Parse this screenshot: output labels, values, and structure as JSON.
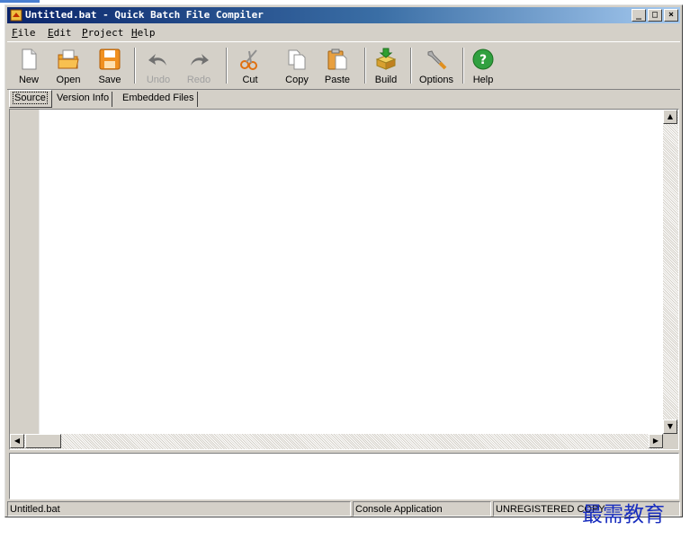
{
  "window": {
    "title": "Untitled.bat - Quick Batch File Compiler",
    "controls": {
      "minimize": "_",
      "maximize": "□",
      "close": "×"
    }
  },
  "menu": [
    {
      "mnemonic": "F",
      "rest": "ile"
    },
    {
      "mnemonic": "E",
      "rest": "dit"
    },
    {
      "mnemonic": "P",
      "rest": "roject"
    },
    {
      "mnemonic": "H",
      "rest": "elp"
    }
  ],
  "toolbar": {
    "new": "New",
    "open": "Open",
    "save": "Save",
    "undo": "Undo",
    "redo": "Redo",
    "cut": "Cut",
    "copy": "Copy",
    "paste": "Paste",
    "build": "Build",
    "options": "Options",
    "help": "Help"
  },
  "tabs": {
    "source": "Source",
    "version_info": "Version Info",
    "embedded_files": "Embedded Files"
  },
  "editor": {
    "content": ""
  },
  "output": {
    "content": ""
  },
  "status": {
    "file": "Untitled.bat",
    "app_type": "Console Application",
    "registration": "UNREGISTERED COPY"
  },
  "watermark": "最需教育",
  "colors": {
    "title_start": "#0a246a",
    "title_end": "#a6caf0",
    "face": "#d4d0c8",
    "watermark": "#1a2fbf"
  }
}
